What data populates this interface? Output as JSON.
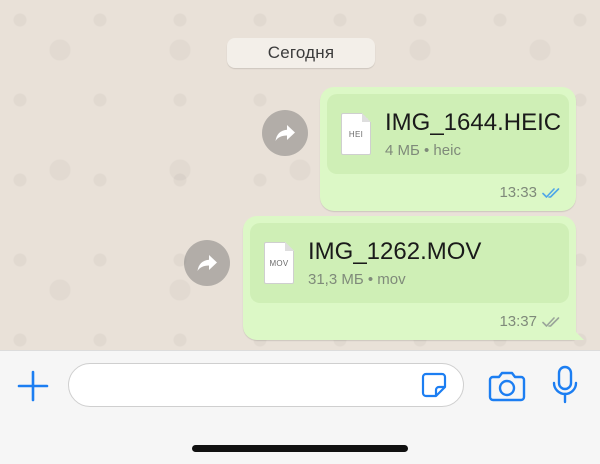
{
  "date_separator": "Сегодня",
  "messages": [
    {
      "file_icon_label": "HEI",
      "file_name": "IMG_1644.HEIC",
      "file_meta": "4 МБ • heic",
      "time": "13:33",
      "status": "read"
    },
    {
      "file_icon_label": "MOV",
      "file_name": "IMG_1262.MOV",
      "file_meta": "31,3 МБ • mov",
      "time": "13:37",
      "status": "delivered"
    }
  ],
  "input_bar": {
    "message_value": "",
    "icons": [
      "plus-icon",
      "sticker-icon",
      "camera-icon",
      "microphone-icon"
    ]
  },
  "colors": {
    "accent": "#1c7ef2",
    "bubble_outgoing": "#dcf8c6",
    "read_ticks": "#4fa6e8",
    "delivered_ticks": "#9aa59a"
  }
}
